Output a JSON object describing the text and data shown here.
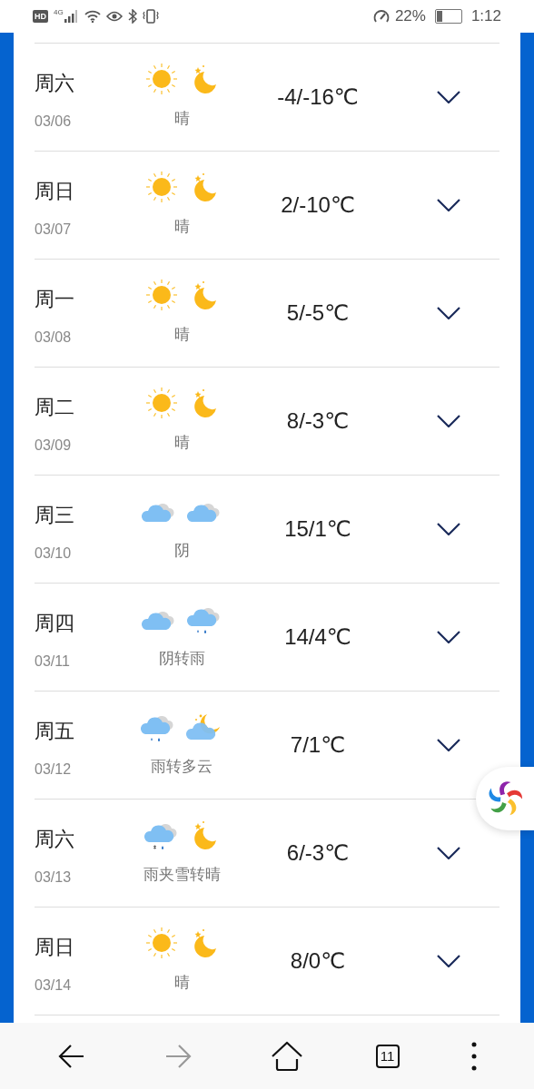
{
  "status_bar": {
    "hd_badge": "HD",
    "network": "4G",
    "battery_percent": "22%",
    "time": "1:12"
  },
  "forecast": [
    {
      "weekday": "周六",
      "date": "03/06",
      "day": {
        "kind": "sun"
      },
      "night": {
        "kind": "moon"
      },
      "condition": "晴",
      "temperature": "-4/-16℃",
      "expanded": false
    },
    {
      "weekday": "周日",
      "date": "03/07",
      "day": {
        "kind": "sun"
      },
      "night": {
        "kind": "moon"
      },
      "condition": "晴",
      "temperature": "2/-10℃",
      "expanded": false
    },
    {
      "weekday": "周一",
      "date": "03/08",
      "day": {
        "kind": "sun"
      },
      "night": {
        "kind": "moon"
      },
      "condition": "晴",
      "temperature": "5/-5℃",
      "expanded": false
    },
    {
      "weekday": "周二",
      "date": "03/09",
      "day": {
        "kind": "sun"
      },
      "night": {
        "kind": "moon"
      },
      "condition": "晴",
      "temperature": "8/-3℃",
      "expanded": false
    },
    {
      "weekday": "周三",
      "date": "03/10",
      "day": {
        "kind": "cloud"
      },
      "night": {
        "kind": "cloud"
      },
      "condition": "阴",
      "temperature": "15/1℃",
      "expanded": false
    },
    {
      "weekday": "周四",
      "date": "03/11",
      "day": {
        "kind": "cloud"
      },
      "night": {
        "kind": "rain"
      },
      "condition": "阴转雨",
      "temperature": "14/4℃",
      "expanded": false
    },
    {
      "weekday": "周五",
      "date": "03/12",
      "day": {
        "kind": "rain"
      },
      "night": {
        "kind": "cloudmoon"
      },
      "condition": "雨转多云",
      "temperature": "7/1℃",
      "expanded": false
    },
    {
      "weekday": "周六",
      "date": "03/13",
      "day": {
        "kind": "sleet"
      },
      "night": {
        "kind": "moon"
      },
      "condition": "雨夹雪转晴",
      "temperature": "6/-3℃",
      "expanded": false
    },
    {
      "weekday": "周日",
      "date": "03/14",
      "day": {
        "kind": "sun"
      },
      "night": {
        "kind": "moon"
      },
      "condition": "晴",
      "temperature": "8/0℃",
      "expanded": false
    }
  ],
  "bottom_bar": {
    "forward_disabled": true,
    "tab_count": "11"
  }
}
